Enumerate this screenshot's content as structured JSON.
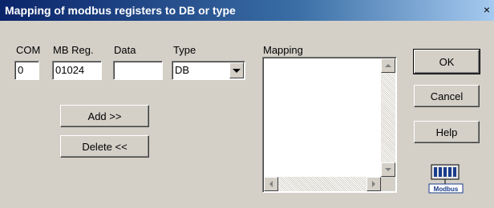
{
  "window": {
    "title": "Mapping of modbus registers to DB or type",
    "close_label": "×"
  },
  "labels": {
    "com": "COM",
    "mb_reg": "MB Reg.",
    "data": "Data",
    "type": "Type",
    "mapping": "Mapping"
  },
  "fields": {
    "com_value": "0",
    "mb_reg_value": "01024",
    "data_value": "",
    "type_value": "DB"
  },
  "buttons": {
    "add": "Add >>",
    "delete": "Delete <<",
    "ok": "OK",
    "cancel": "Cancel",
    "help": "Help"
  },
  "logo": {
    "text": "Modbus",
    "accent": "#1a3c8c"
  }
}
